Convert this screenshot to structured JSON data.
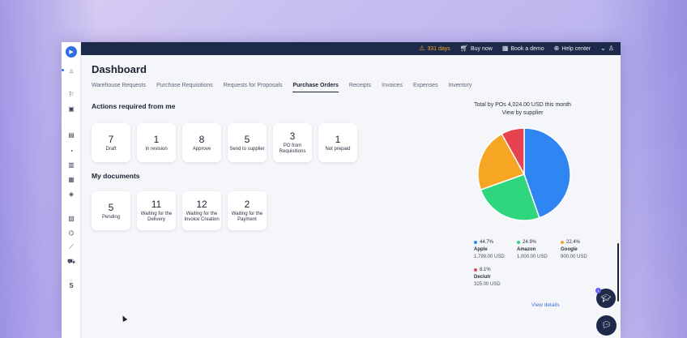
{
  "topbar": {
    "trial": "331 days",
    "buy_now": "Buy now",
    "book_demo": "Book a demo",
    "help_center": "Help center"
  },
  "page": {
    "title": "Dashboard"
  },
  "tabs": [
    {
      "label": "Warehouse Requests",
      "active": false
    },
    {
      "label": "Purchase Requisitions",
      "active": false
    },
    {
      "label": "Requests for Proposals",
      "active": false
    },
    {
      "label": "Purchase Orders",
      "active": true
    },
    {
      "label": "Receipts",
      "active": false
    },
    {
      "label": "Invoices",
      "active": false
    },
    {
      "label": "Expenses",
      "active": false
    },
    {
      "label": "Inventory",
      "active": false
    }
  ],
  "actions": {
    "title": "Actions required from me",
    "cards": [
      {
        "num": "7",
        "label": "Draft"
      },
      {
        "num": "1",
        "label": "In revision"
      },
      {
        "num": "8",
        "label": "Approve"
      },
      {
        "num": "5",
        "label": "Send to supplier"
      },
      {
        "num": "3",
        "label": "PO from Requisitions"
      },
      {
        "num": "1",
        "label": "Not prepaid"
      }
    ]
  },
  "documents": {
    "title": "My documents",
    "cards": [
      {
        "num": "5",
        "label": "Pending"
      },
      {
        "num": "11",
        "label": "Waiting for the Delivery"
      },
      {
        "num": "12",
        "label": "Waiting for the Invoice Creation"
      },
      {
        "num": "2",
        "label": "Waiting for the Payment"
      }
    ]
  },
  "chart_data": {
    "type": "pie",
    "title": "Total by POs 4,024.00 USD this month",
    "subtitle": "View by supplier",
    "series": [
      {
        "name": "Apple",
        "value": 44.7,
        "pct": "44.7%",
        "amount": "1,799.00 USD",
        "color": "#2f86f2"
      },
      {
        "name": "Amazon",
        "value": 24.9,
        "pct": "24.9%",
        "amount": "1,000.00 USD",
        "color": "#2ed67e"
      },
      {
        "name": "Google",
        "value": 22.4,
        "pct": "22.4%",
        "amount": "900.00 USD",
        "color": "#f6a623"
      },
      {
        "name": "Declutr",
        "value": 8.1,
        "pct": "8.1%",
        "amount": "325.00 USD",
        "color": "#e8424f"
      }
    ]
  },
  "chart_link": "View details",
  "fab_badge": "1"
}
